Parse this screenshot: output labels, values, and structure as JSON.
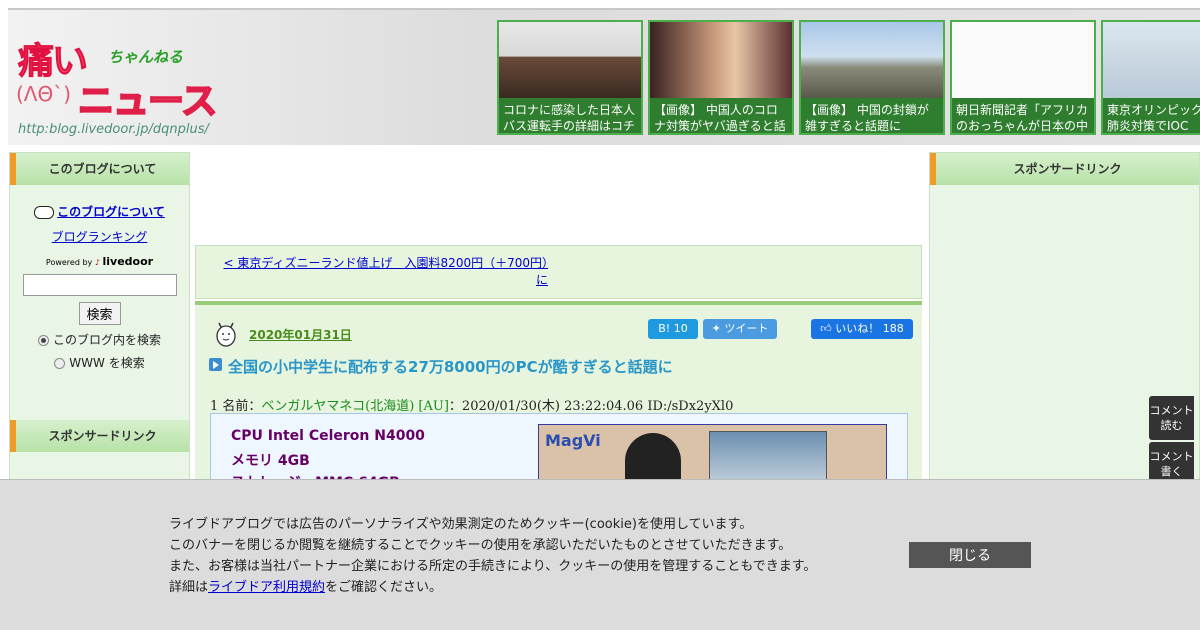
{
  "header": {
    "logo_main": "痛い",
    "logo_sub": "ちゃんねる",
    "logo_face": "(ΛΘ`)",
    "logo_news": "ニュース",
    "logo_url": "http:blog.livedoor.jp/dqnplus/",
    "thumbs": [
      {
        "text": "コロナに感染した日本人バス運転手の詳細はコチラ"
      },
      {
        "text": "【画像】 中国人のコロナ対策がヤバ過ぎると話題に"
      },
      {
        "text": "【画像】 中国の封鎖が雑すぎると話題に"
      },
      {
        "text": "朝日新聞記者「アフリカのおっちゃんが日本の中年男"
      },
      {
        "text": "東京オリンピック中新型肺炎対策でIOC"
      }
    ]
  },
  "left_sidebar": {
    "heading": "このブログについて",
    "about_link": "このブログについて",
    "ranking_link": "ブログランキング",
    "powered_by": "Powered by",
    "powered_brand": "livedoor",
    "search_button": "検索",
    "radio_blog": "このブログ内を検索",
    "radio_www": "WWW を検索",
    "sponsor_heading": "スポンサードリンク"
  },
  "right_sidebar": {
    "sponsor_heading": "スポンサードリンク"
  },
  "main": {
    "prev_link": "< 東京ディズニーランド値上げ　入園料8200円（＋700円）に",
    "date": "2020年01月31日",
    "hatena_label": "B! 10",
    "tweet_label": "ツイート",
    "like_label": "いいね！ 188",
    "title": "全国の小中学生に配布する27万8000円のPCが酷すぎると話題に",
    "res_num": "1 名前：",
    "res_name": "ベンガルヤマネコ(北海道) [AU]",
    "res_meta": "：2020/01/30(木) 23:22:04.06 ID:/sDx2yXl0",
    "specs": [
      "CPU Intel Celeron N4000",
      "メモリ 4GB",
      "ストレージ eMMC 64GB"
    ],
    "ad_logo": "MagVi"
  },
  "comment_buttons": [
    "コメント読む",
    "コメント書く"
  ],
  "cookie": {
    "line1": "ライブドアブログでは広告のパーソナライズや効果測定のためクッキー(cookie)を使用しています。",
    "line2": "このバナーを閉じるか閲覧を継続することでクッキーの使用を承認いただいたものとさせていただきます。",
    "line3": "また、お客様は当社パートナー企業における所定の手続きにより、クッキーの使用を管理することもできます。",
    "line4_pre": "詳細は",
    "line4_link": "ライブドア利用規約",
    "line4_post": "をご確認ください。",
    "close_label": "閉じる"
  }
}
